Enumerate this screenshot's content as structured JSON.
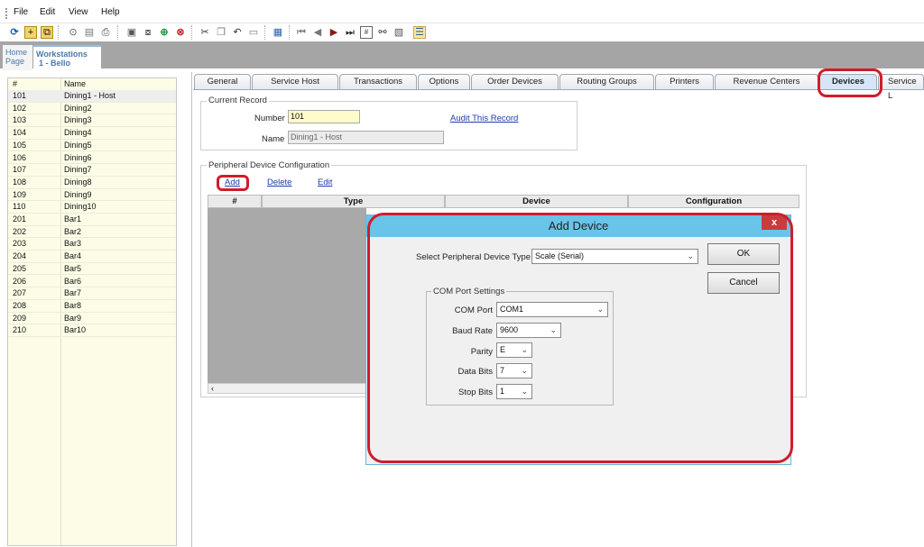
{
  "menu": {
    "items": [
      "File",
      "Edit",
      "View",
      "Help"
    ]
  },
  "page_tabs": {
    "home_line1": "Home",
    "home_line2": "Page",
    "ws_line1": "Workstations",
    "ws_line2": "1 - Bello"
  },
  "list": {
    "headers": {
      "num": "#",
      "name": "Name"
    },
    "rows": [
      {
        "num": "101",
        "name": "Dining1 - Host"
      },
      {
        "num": "102",
        "name": "Dining2"
      },
      {
        "num": "103",
        "name": "Dining3"
      },
      {
        "num": "104",
        "name": "Dining4"
      },
      {
        "num": "105",
        "name": "Dining5"
      },
      {
        "num": "106",
        "name": "Dining6"
      },
      {
        "num": "107",
        "name": "Dining7"
      },
      {
        "num": "108",
        "name": "Dining8"
      },
      {
        "num": "109",
        "name": "Dining9"
      },
      {
        "num": "110",
        "name": "Dining10"
      },
      {
        "num": "201",
        "name": "Bar1"
      },
      {
        "num": "202",
        "name": "Bar2"
      },
      {
        "num": "203",
        "name": "Bar3"
      },
      {
        "num": "204",
        "name": "Bar4"
      },
      {
        "num": "205",
        "name": "Bar5"
      },
      {
        "num": "206",
        "name": "Bar6"
      },
      {
        "num": "207",
        "name": "Bar7"
      },
      {
        "num": "208",
        "name": "Bar8"
      },
      {
        "num": "209",
        "name": "Bar9"
      },
      {
        "num": "210",
        "name": "Bar10"
      }
    ]
  },
  "tabs": [
    "General",
    "Service Host",
    "Transactions",
    "Options",
    "Order Devices",
    "Routing Groups",
    "Printers",
    "Revenue Centers",
    "Devices",
    "Service L"
  ],
  "active_tab": "Devices",
  "current_record": {
    "group_label": "Current Record",
    "number_label": "Number",
    "number_value": "101",
    "name_label": "Name",
    "name_value": "Dining1 - Host",
    "audit_link": "Audit This Record"
  },
  "peripheral": {
    "group_label": "Peripheral Device Configuration",
    "add": "Add",
    "delete": "Delete",
    "edit": "Edit",
    "columns": [
      "#",
      "Type",
      "Device",
      "Configuration"
    ]
  },
  "dialog": {
    "title": "Add Device",
    "close": "x",
    "type_label": "Select Peripheral Device Type",
    "type_value": "Scale (Serial)",
    "ok": "OK",
    "cancel": "Cancel",
    "com_group": "COM Port Settings",
    "com_port_label": "COM Port",
    "com_port_value": "COM1",
    "baud_label": "Baud Rate",
    "baud_value": "9600",
    "parity_label": "Parity",
    "parity_value": "E",
    "data_bits_label": "Data Bits",
    "data_bits_value": "7",
    "stop_bits_label": "Stop Bits",
    "stop_bits_value": "1"
  },
  "colors": {
    "highlight_ring": "#d01c2a",
    "dialog_title_bg": "#68c4e8",
    "list_bg": "#fdfde7"
  }
}
